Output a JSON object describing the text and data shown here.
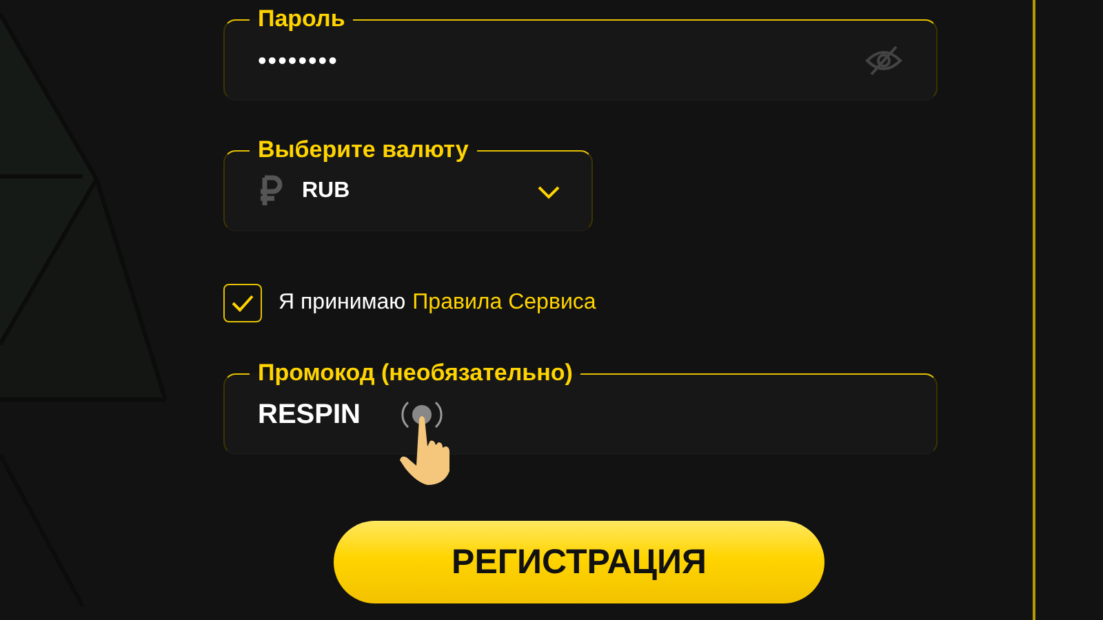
{
  "password": {
    "label": "Пароль",
    "value": "••••••••",
    "visible": false
  },
  "currency": {
    "label": "Выберите валюту",
    "value": "RUB",
    "expanded": false
  },
  "terms": {
    "checked": true,
    "text": "Я принимаю",
    "link": "Правила Сервиса"
  },
  "promo": {
    "label": "Промокод (необязательно)",
    "value": "RESPIN"
  },
  "submit": {
    "label": "РЕГИСТРАЦИЯ"
  }
}
